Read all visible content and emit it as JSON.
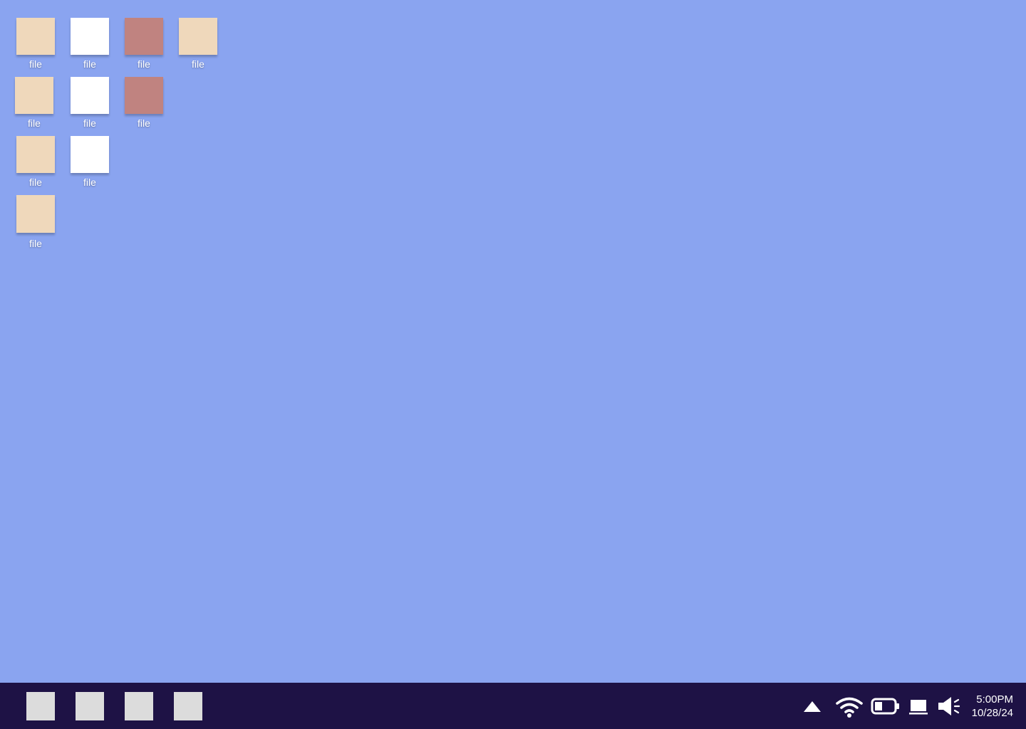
{
  "desktop": {
    "background_color": "#8aa4f0",
    "icons": [
      {
        "label": "file",
        "color": "#efd8bb"
      },
      {
        "label": "file",
        "color": "#ffffff"
      },
      {
        "label": "file",
        "color": "#c08380"
      },
      {
        "label": "file",
        "color": "#efd8bb"
      },
      {
        "label": "file",
        "color": "#efd8bb"
      },
      {
        "label": "file",
        "color": "#ffffff"
      },
      {
        "label": "file",
        "color": "#c08380"
      },
      {
        "label": "file",
        "color": "#efd8bb"
      },
      {
        "label": "file",
        "color": "#ffffff"
      },
      {
        "label": "file",
        "color": "#efd8bb"
      }
    ]
  },
  "taskbar": {
    "background_color": "#1e1245",
    "apps": [
      {
        "name": "app-1",
        "color": "#dcdcdc"
      },
      {
        "name": "app-2",
        "color": "#dcdcdc"
      },
      {
        "name": "app-3",
        "color": "#dcdcdc"
      },
      {
        "name": "app-4",
        "color": "#dcdcdc"
      }
    ],
    "tray": {
      "icons": [
        "show-hidden-icon",
        "wifi-icon",
        "battery-icon",
        "display-icon",
        "volume-icon"
      ],
      "battery_level": 0.4,
      "time": "5:00PM",
      "date": "10/28/24"
    }
  }
}
